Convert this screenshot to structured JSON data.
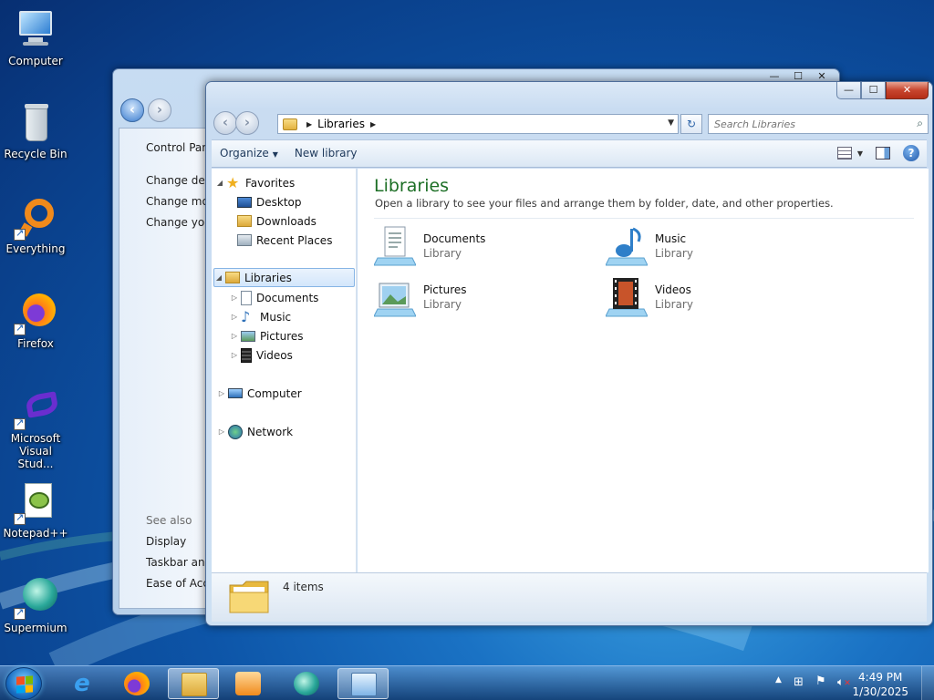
{
  "desktop": {
    "icons": [
      {
        "label": "Computer"
      },
      {
        "label": "Recycle Bin"
      },
      {
        "label": "Everything"
      },
      {
        "label": "Firefox"
      },
      {
        "label": "Microsoft Visual Stud..."
      },
      {
        "label": "Notepad++"
      },
      {
        "label": "Supermium"
      }
    ]
  },
  "back_window": {
    "links": {
      "control_panel": "Control Pane",
      "change_desk": "Change desk",
      "change_mo": "Change mo",
      "change_you": "Change you",
      "see_also": "See also",
      "display": "Display",
      "taskbar": "Taskbar and",
      "ease": "Ease of Acce"
    }
  },
  "explorer": {
    "caption_buttons": {
      "minimize": "—",
      "maximize": "☐",
      "close": "✕"
    },
    "address": {
      "segment": "Libraries"
    },
    "search": {
      "placeholder": "Search Libraries"
    },
    "toolbar": {
      "organize": "Organize",
      "new_library": "New library"
    },
    "navpane": {
      "favorites": "Favorites",
      "desktop": "Desktop",
      "downloads": "Downloads",
      "recent_places": "Recent Places",
      "libraries": "Libraries",
      "documents": "Documents",
      "music": "Music",
      "pictures": "Pictures",
      "videos": "Videos",
      "computer": "Computer",
      "network": "Network"
    },
    "content": {
      "title": "Libraries",
      "description": "Open a library to see your files and arrange them by folder, date, and other properties.",
      "libraries": [
        {
          "name": "Documents",
          "type": "Library"
        },
        {
          "name": "Music",
          "type": "Library"
        },
        {
          "name": "Pictures",
          "type": "Library"
        },
        {
          "name": "Videos",
          "type": "Library"
        }
      ]
    },
    "details": {
      "count": "4 items"
    }
  },
  "taskbar": {
    "apps": [
      "start-orb",
      "internet-explorer",
      "firefox",
      "windows-explorer",
      "media-player",
      "supermium",
      "control-panel"
    ],
    "clock": {
      "time": "4:49 PM",
      "date": "1/30/2025"
    }
  },
  "colors": {
    "title_green": "#1d6f26",
    "close_red": "#c7452e",
    "taskbar": "#1c4e86"
  }
}
